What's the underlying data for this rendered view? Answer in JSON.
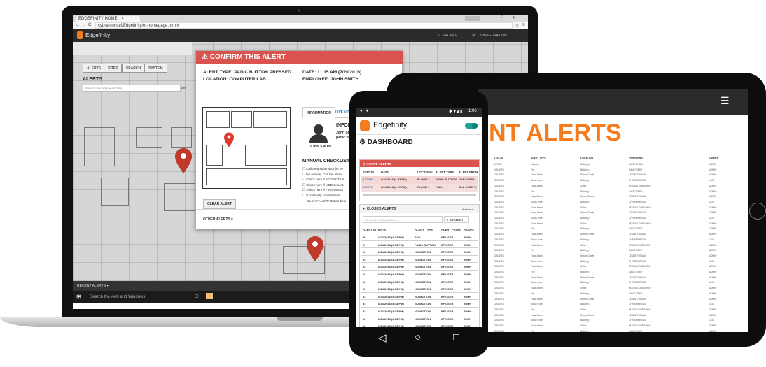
{
  "laptop": {
    "browser_tab": "EDGEFINITY HOME",
    "url": "cybra.com/ef/Edgefinity/ef-homepage.html#",
    "app_name": "Edgefinity",
    "menu_profile": "PROFILE",
    "menu_configuration": "CONFIGURATION",
    "tabs": [
      "ALERTS",
      "SITES",
      "SEARCH",
      "SYSTEM"
    ],
    "sidebar_heading": "ALERTS",
    "search_placeholder": "Search For a Specific Site...",
    "search_button": "Set",
    "recent_alerts": "RECENT ALERTS",
    "taskbar_search": "Search the web and Windows",
    "modal": {
      "title": "CONFIRM THIS ALERT",
      "alert_type": "ALERT TYPE: PANIC BUTTON PRESSED",
      "location": "LOCATION: COMPUTER LAB",
      "date": "DATE: 11:15 AM (7/20/2016)",
      "employee": "EMPLOYEE: JOHN SMITH",
      "tab_information": "INFORMATION",
      "tab_live_video": "LIVE VIDEO",
      "person_name": "JOHN SMITH",
      "info_heading": "INFORMA",
      "info_line1": "John Smith",
      "info_line2": "panic butto",
      "manual_checklist": "MANUAL CHECKLIST",
      "checklist": [
        "Call area supervisor for av",
        "No answer, Call the alerte",
        "Check here if SECURITY A",
        "Check here if MEDICAL AL",
        "Check here if FIRE/DISAST",
        "If positively confirmed as t"
      ],
      "checklist_cut": "'CLEAR ALERT' Button belo",
      "clear_alert": "CLEAR ALERT",
      "other_alerts": "OTHER ALERTS"
    }
  },
  "tablet": {
    "title": "NT ALERTS",
    "columns": [
      "STATUS",
      "ALERT TYPE",
      "LOCATION",
      "PERSONNEL",
      "OWNER"
    ],
    "rows": [
      [
        "ACTIVE",
        "Intrusion",
        "Building 2",
        "JIMMY O'NEIL",
        "ADMIN"
      ],
      [
        "CLEARED",
        "Fire",
        "Building 4",
        "DAVID GREY",
        "ADMIN"
      ],
      [
        "CLEARED",
        "False Alarm",
        "Server Closet",
        "LESLIE THOMAS",
        "ADMIN"
      ],
      [
        "CLEARED",
        "Blown Fuse",
        "Building 4",
        "CHRIS RUBENS",
        "LUIS"
      ],
      [
        "CLEARED",
        "False Alarm",
        "Office",
        "JESSICA GREGORIO",
        "ADMIN"
      ],
      [
        "CLEARED",
        "Fire",
        "Building 4",
        "DAVID GREY",
        "ADMIN"
      ],
      [
        "CLEARED",
        "False Alarm",
        "Server Closet",
        "LESLIE THOMAS",
        "ADMIN"
      ],
      [
        "CLEARED",
        "Blown Fuse",
        "Building 4",
        "CHRIS RUBENS",
        "LUIS"
      ],
      [
        "CLEARED",
        "False Alarm",
        "Office",
        "JESSICA GREGORIO",
        "ADMIN"
      ],
      [
        "CLEARED",
        "False Alarm",
        "Server Closet",
        "LESLIE THOMAS",
        "ADMIN"
      ],
      [
        "CLEARED",
        "Blown Fuse",
        "Building 4",
        "CHRIS RUBENS",
        "LUIS"
      ],
      [
        "CLEARED",
        "False Alarm",
        "Office",
        "JESSICA GREGORIO",
        "ADMIN"
      ],
      [
        "CLEARED",
        "Fire",
        "Building 4",
        "DAVID GREY",
        "ADMIN"
      ],
      [
        "CLEARED",
        "False Alarm",
        "Server Closet",
        "LESLIE THOMAS",
        "ADMIN"
      ],
      [
        "CLEARED",
        "Blown Fuse",
        "Building 4",
        "CHRIS RUBENS",
        "LUIS"
      ],
      [
        "CLEARED",
        "False Alarm",
        "Office",
        "JESSICA GREGORIO",
        "ADMIN"
      ],
      [
        "CLEARED",
        "Fire",
        "Building 4",
        "DAVID GREY",
        "ADMIN"
      ],
      [
        "CLEARED",
        "False Alarm",
        "Server Closet",
        "LESLIE THOMAS",
        "ADMIN"
      ],
      [
        "CLEARED",
        "Blown Fuse",
        "Building 4",
        "CHRIS RUBENS",
        "LUIS"
      ],
      [
        "CLEARED",
        "False Alarm",
        "Office",
        "JESSICA GREGORIO",
        "ADMIN"
      ],
      [
        "CLEARED",
        "Fire",
        "Building 4",
        "DAVID GREY",
        "ADMIN"
      ],
      [
        "CLEARED",
        "False Alarm",
        "Server Closet",
        "LESLIE THOMAS",
        "ADMIN"
      ],
      [
        "CLEARED",
        "Blown Fuse",
        "Building 4",
        "CHRIS RUBENS",
        "LUIS"
      ],
      [
        "CLEARED",
        "False Alarm",
        "Office",
        "JESSICA GREGORIO",
        "ADMIN"
      ],
      [
        "CLEARED",
        "Fire",
        "Building 4",
        "DAVID GREY",
        "ADMIN"
      ],
      [
        "CLEARED",
        "False Alarm",
        "Server Closet",
        "LESLIE THOMAS",
        "ADMIN"
      ],
      [
        "CLEARED",
        "Blown Fuse",
        "Building 4",
        "CHRIS RUBENS",
        "LUIS"
      ],
      [
        "CLEARED",
        "Fire",
        "Office",
        "JESSICA GREGORIO",
        "ADMIN"
      ],
      [
        "CLEARED",
        "False Alarm",
        "Server Closet",
        "LESLIE THOMAS",
        "ADMIN"
      ],
      [
        "CLEARED",
        "Blown Fuse",
        "Building 4",
        "CHRIS RUBENS",
        "LUIS"
      ],
      [
        "CLEARED",
        "False Alarm",
        "Office",
        "JESSICA GREGORIO",
        "ADMIN"
      ],
      [
        "CLEARED",
        "Fire",
        "Building 4",
        "DAVID GREY",
        "ADMIN"
      ]
    ]
  },
  "phone": {
    "status_time": "1:06",
    "app_name": "Edgefinity",
    "dashboard": "DASHBOARD",
    "active_alerts": "ACTIVE ALERTS",
    "active_columns": [
      "STATUS",
      "DATE",
      "LOCATION",
      "ALERT TYPE",
      "ALERT FROM"
    ],
    "active_rows": [
      [
        "ACTIVE",
        "8/24/2016 (4:33 PM)",
        "FLOOR 2",
        "PANIC BUTTON",
        "DAN SMITH"
      ],
      [
        "ACTIVE",
        "8/24/2016 (4:27 PM)",
        "FLOOR 1",
        "FALL",
        "JILL JOSEPH"
      ]
    ],
    "closed_alerts": "CLOSED ALERTS",
    "actions": "Actions",
    "search_placeholder": "Search For Closed Alerts...",
    "search_button": "SEARCH",
    "closed_columns": [
      "ALERT ID",
      "DATE",
      "ALERT TYPE",
      "ALERT FROM",
      "RESPO"
    ],
    "closed_rows": [
      [
        "90",
        "8/24/2016 (4:33 PM)",
        "FALL",
        "EF USER",
        "JOHN"
      ],
      [
        "91",
        "8/24/2016 (4:33 PM)",
        "PANIC BUTTON",
        "EF USER",
        "JOHN"
      ],
      [
        "92",
        "8/24/2016 (4:33 PM)",
        "NO MOTION",
        "EF USER",
        "JOHN"
      ],
      [
        "92",
        "8/24/2016 (4:33 PM)",
        "NO MOTION",
        "EF USER",
        "JOHN"
      ],
      [
        "92",
        "8/24/2016 (4:33 PM)",
        "NO MOTION",
        "EF USER",
        "JOHN"
      ],
      [
        "92",
        "8/24/2016 (4:33 PM)",
        "NO MOTION",
        "EF USER",
        "JOHN"
      ],
      [
        "92",
        "8/24/2016 (4:33 PM)",
        "NO MOTION",
        "EF USER",
        "JOHN"
      ],
      [
        "92",
        "8/24/2016 (4:33 PM)",
        "NO MOTION",
        "EF USER",
        "JOHN"
      ],
      [
        "92",
        "8/24/2016 (4:33 PM)",
        "NO MOTION",
        "EF USER",
        "JOHN"
      ],
      [
        "92",
        "8/24/2016 (4:33 PM)",
        "NO MOTION",
        "EF USER",
        "JOHN"
      ],
      [
        "92",
        "8/24/2016 (4:33 PM)",
        "NO MOTION",
        "EF USER",
        "JOHN"
      ],
      [
        "92",
        "8/24/2016 (4:33 PM)",
        "NO MOTION",
        "EF USER",
        "JOHN"
      ],
      [
        "92",
        "8/24/2016 (4:33 PM)",
        "NO MOTION",
        "EF USER",
        "JOHN"
      ]
    ]
  },
  "colors": {
    "alert_red": "#d9534f",
    "brand_orange": "#f47c1f",
    "dark_bar": "#2b2b2b",
    "toggle_teal": "#1aa39a"
  }
}
